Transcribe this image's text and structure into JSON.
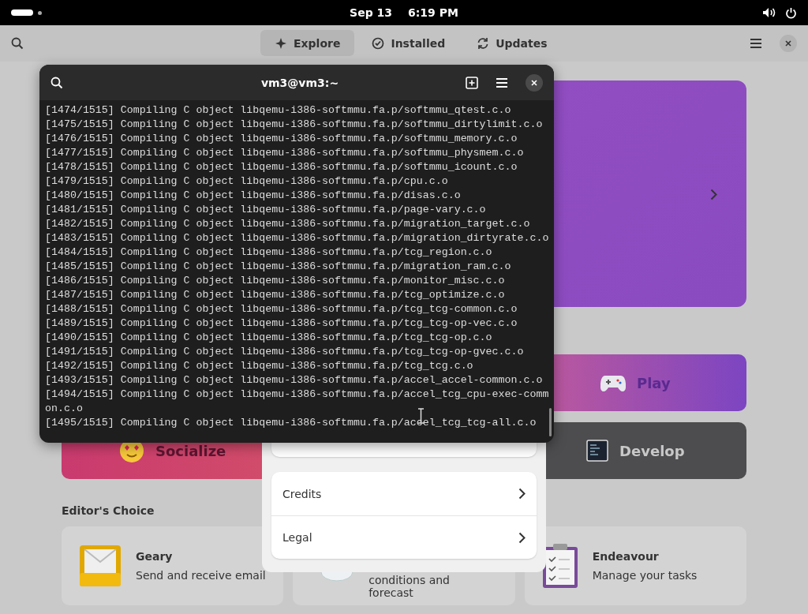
{
  "top_bar": {
    "date": "Sep 13",
    "time": "6:19 PM"
  },
  "software": {
    "tabs": [
      {
        "label": "Explore",
        "selected": true,
        "kind": "explore"
      },
      {
        "label": "Installed",
        "selected": false,
        "kind": "installed"
      },
      {
        "label": "Updates",
        "selected": false,
        "kind": "updates"
      }
    ],
    "categories": [
      {
        "label": "Play",
        "kind": "play"
      },
      {
        "label": "Socialize",
        "kind": "socialize"
      },
      {
        "label": "Develop",
        "kind": "develop"
      }
    ],
    "editors_choice": {
      "title": "Editor's Choice",
      "apps": [
        {
          "name": "Geary",
          "description": "Send and receive email",
          "kind": "mail"
        },
        {
          "description": "conditions and forecast",
          "kind": "weather"
        },
        {
          "name": "Endeavour",
          "description": "Manage your tasks",
          "kind": "tasks"
        }
      ]
    }
  },
  "terminal": {
    "title": "vm3@vm3:~",
    "lines": [
      "[1474/1515] Compiling C object libqemu-i386-softmmu.fa.p/softmmu_qtest.c.o",
      "[1475/1515] Compiling C object libqemu-i386-softmmu.fa.p/softmmu_dirtylimit.c.o",
      "[1476/1515] Compiling C object libqemu-i386-softmmu.fa.p/softmmu_memory.c.o",
      "[1477/1515] Compiling C object libqemu-i386-softmmu.fa.p/softmmu_physmem.c.o",
      "[1478/1515] Compiling C object libqemu-i386-softmmu.fa.p/softmmu_icount.c.o",
      "[1479/1515] Compiling C object libqemu-i386-softmmu.fa.p/cpu.c.o",
      "[1480/1515] Compiling C object libqemu-i386-softmmu.fa.p/disas.c.o",
      "[1481/1515] Compiling C object libqemu-i386-softmmu.fa.p/page-vary.c.o",
      "[1482/1515] Compiling C object libqemu-i386-softmmu.fa.p/migration_target.c.o",
      "[1483/1515] Compiling C object libqemu-i386-softmmu.fa.p/migration_dirtyrate.c.o",
      "[1484/1515] Compiling C object libqemu-i386-softmmu.fa.p/tcg_region.c.o",
      "[1485/1515] Compiling C object libqemu-i386-softmmu.fa.p/migration_ram.c.o",
      "[1486/1515] Compiling C object libqemu-i386-softmmu.fa.p/monitor_misc.c.o",
      "[1487/1515] Compiling C object libqemu-i386-softmmu.fa.p/tcg_optimize.c.o",
      "[1488/1515] Compiling C object libqemu-i386-softmmu.fa.p/tcg_tcg-common.c.o",
      "[1489/1515] Compiling C object libqemu-i386-softmmu.fa.p/tcg_tcg-op-vec.c.o",
      "[1490/1515] Compiling C object libqemu-i386-softmmu.fa.p/tcg_tcg-op.c.o",
      "[1491/1515] Compiling C object libqemu-i386-softmmu.fa.p/tcg_tcg-op-gvec.c.o",
      "[1492/1515] Compiling C object libqemu-i386-softmmu.fa.p/tcg_tcg.c.o",
      "[1493/1515] Compiling C object libqemu-i386-softmmu.fa.p/accel_accel-common.c.o",
      "[1494/1515] Compiling C object libqemu-i386-softmmu.fa.p/accel_tcg_cpu-exec-common.c.o",
      "[1495/1515] Compiling C object libqemu-i386-softmmu.fa.p/accel_tcg_tcg-all.c.o"
    ]
  },
  "about_dialog": {
    "rows": [
      {
        "label": "Credits"
      },
      {
        "label": "Legal"
      }
    ]
  }
}
